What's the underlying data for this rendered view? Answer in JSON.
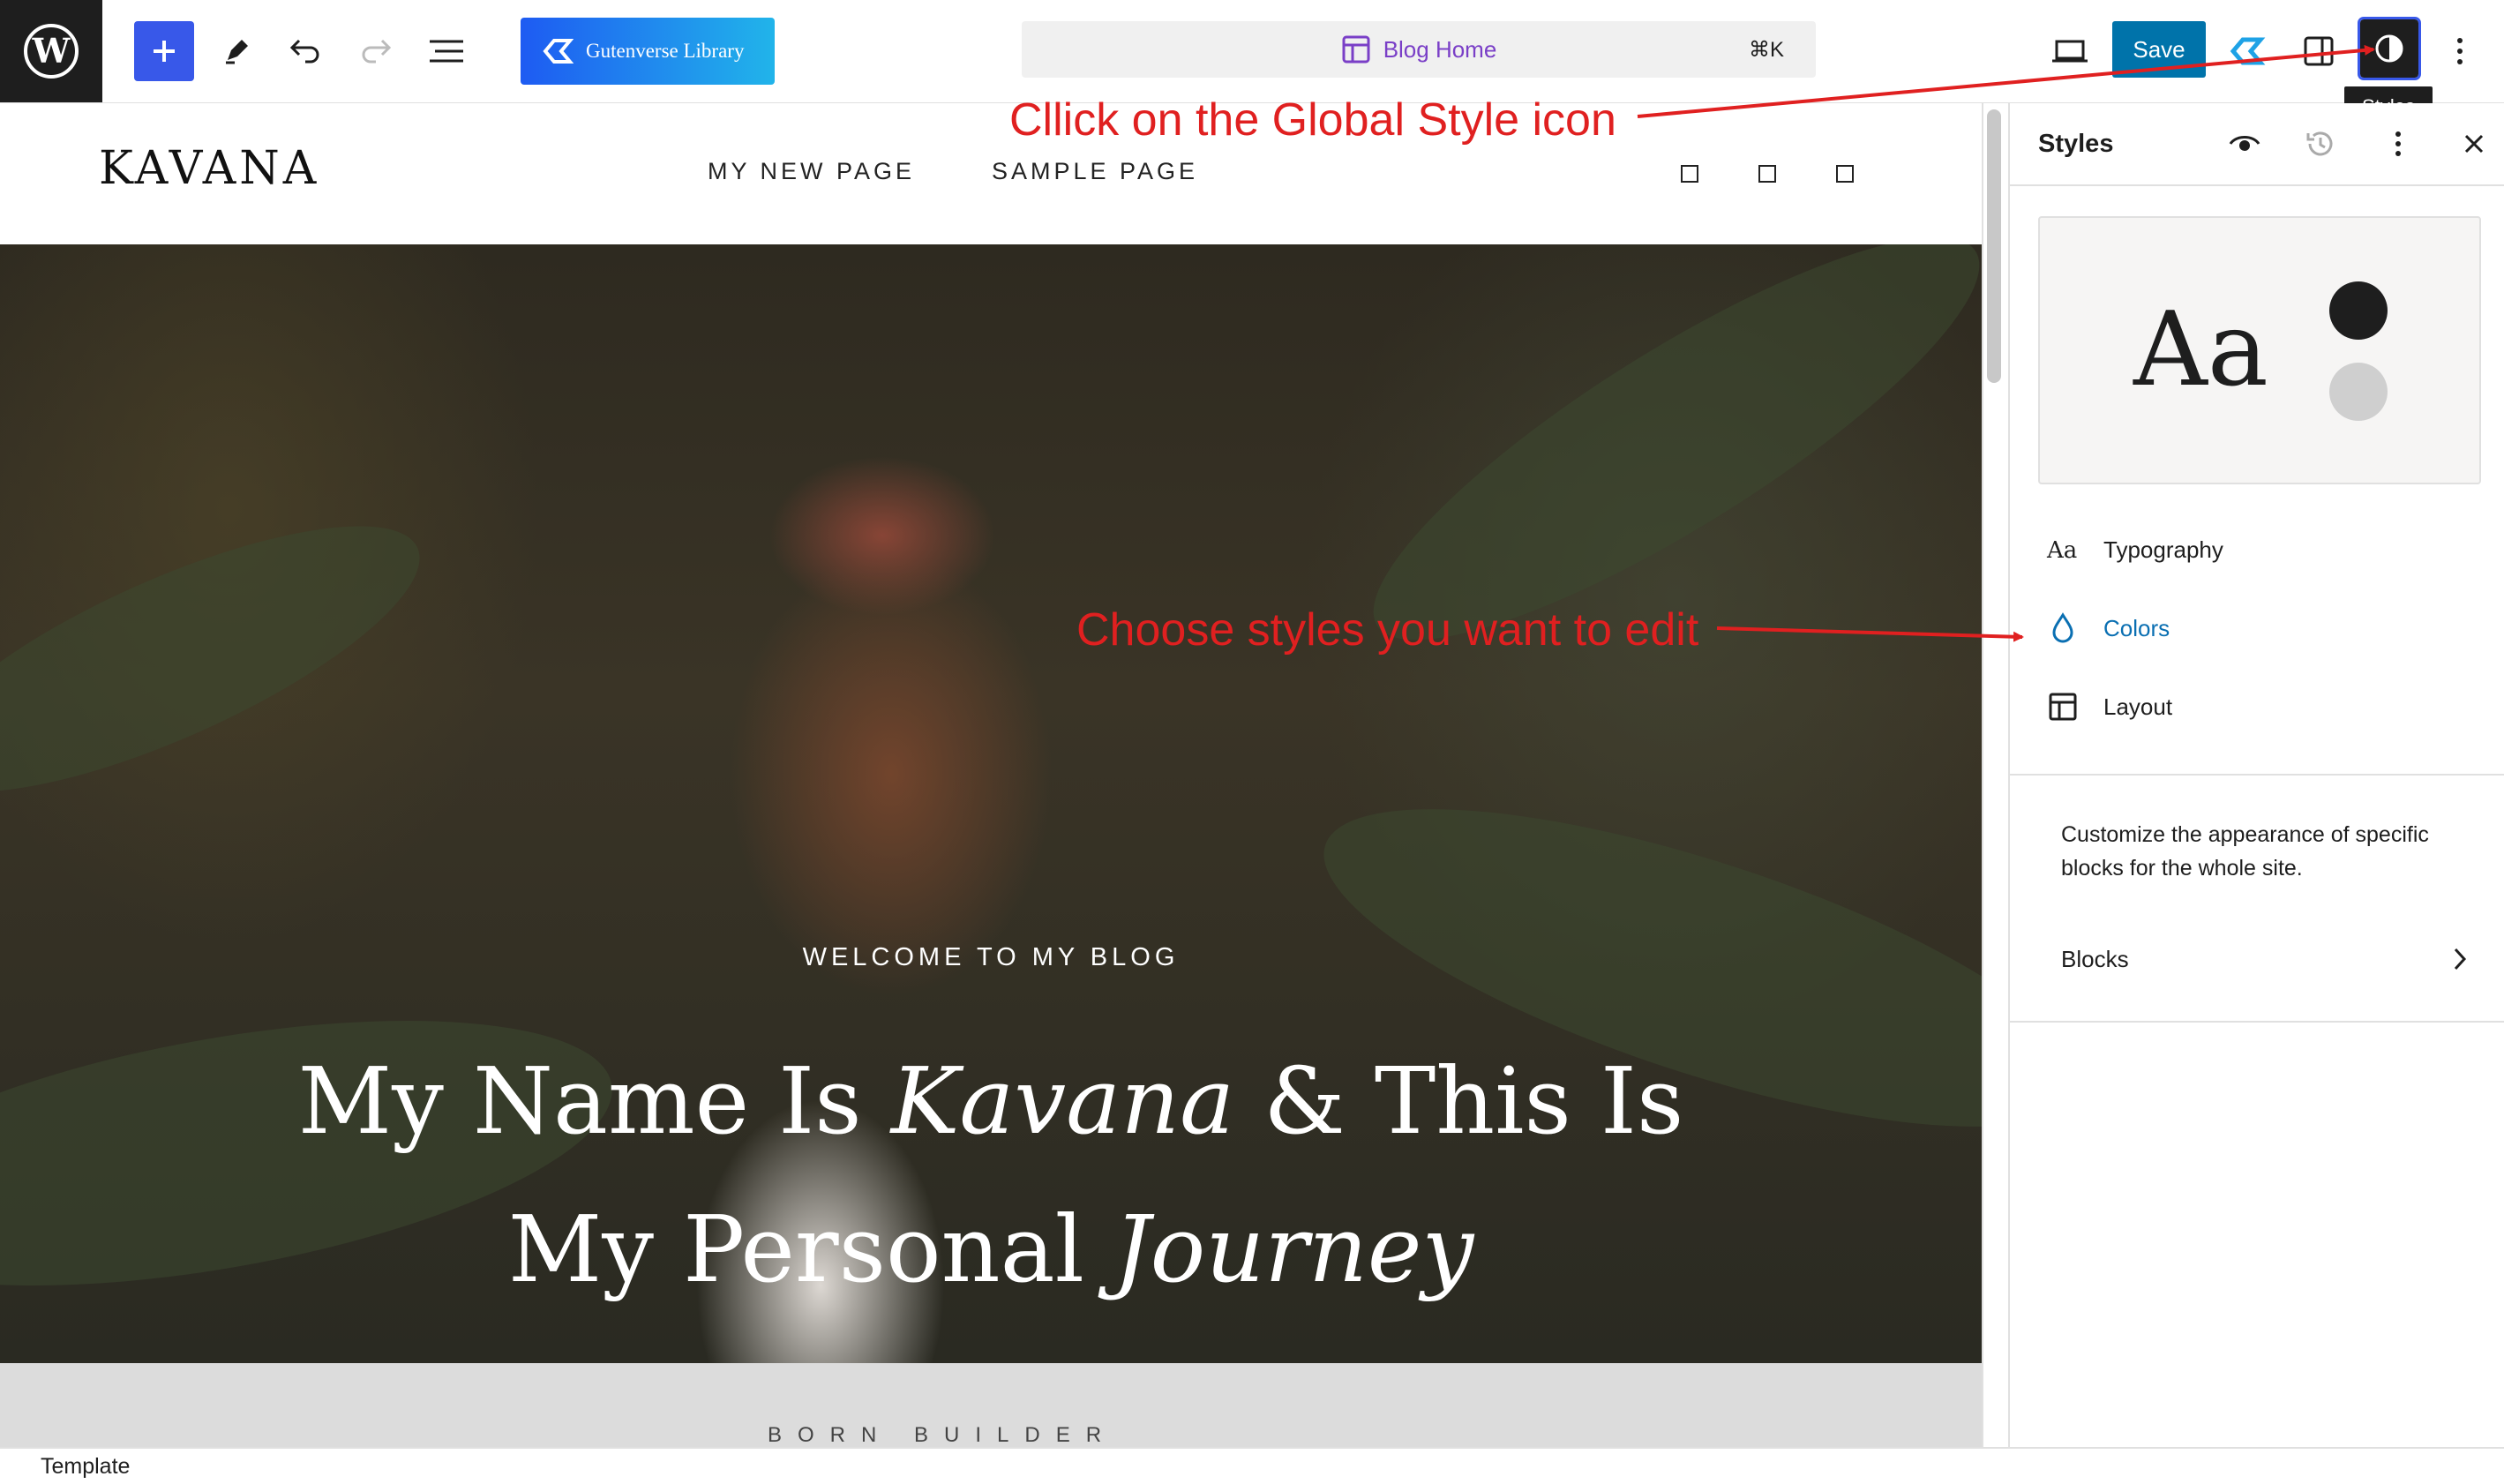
{
  "toolbar": {
    "library_label": "Gutenverse Library",
    "document_title": "Blog Home",
    "shortcut": "⌘K",
    "save_label": "Save",
    "tooltip": "Styles"
  },
  "site": {
    "title": "KAVANA",
    "nav": [
      "MY NEW PAGE",
      "SAMPLE PAGE"
    ]
  },
  "hero": {
    "kicker": "WELCOME TO MY BLOG",
    "line1_a": "My Name Is ",
    "line1_em": "Kavana",
    "line1_b": " & This Is",
    "line2_a": "My Personal ",
    "line2_em": "Journey",
    "below_text": "BORN BUILDER"
  },
  "sidebar": {
    "title": "Styles",
    "preview_text": "Aa",
    "items": [
      {
        "label": "Typography",
        "icon": "typography-icon"
      },
      {
        "label": "Colors",
        "icon": "droplet-icon"
      },
      {
        "label": "Layout",
        "icon": "layout-icon"
      }
    ],
    "description": "Customize the appearance of specific blocks for the whole site.",
    "blocks_label": "Blocks"
  },
  "footer": {
    "label": "Template"
  },
  "annotations": {
    "global_style": "Cllick on the Global Style icon",
    "choose_styles": "Choose styles you want to edit"
  },
  "colors": {
    "accent_blue": "#3858e9",
    "save_blue": "#0073aa",
    "annotation_red": "#e02020",
    "colors_item": "#0a6fb2",
    "swatch_dark": "#1e1e1e",
    "swatch_light": "#cfcfcf"
  }
}
